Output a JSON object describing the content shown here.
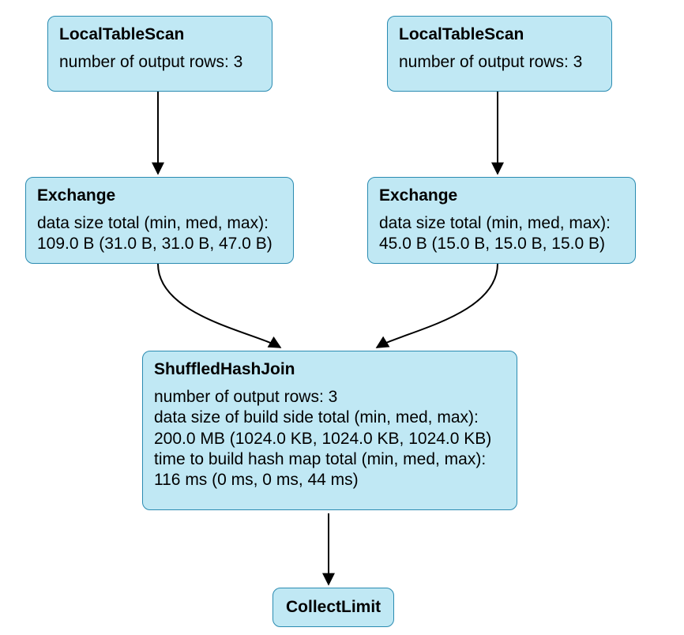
{
  "nodes": {
    "lts_left": {
      "title": "LocalTableScan",
      "body": "number of output rows: 3"
    },
    "lts_right": {
      "title": "LocalTableScan",
      "body": "number of output rows: 3"
    },
    "exchange_left": {
      "title": "Exchange",
      "body": "data size total (min, med, max):\n109.0 B (31.0 B, 31.0 B, 47.0 B)"
    },
    "exchange_right": {
      "title": "Exchange",
      "body": "data size total (min, med, max):\n45.0 B (15.0 B, 15.0 B, 15.0 B)"
    },
    "shj": {
      "title": "ShuffledHashJoin",
      "body": "number of output rows: 3\ndata size of build side total (min, med, max):\n200.0 MB (1024.0 KB, 1024.0 KB, 1024.0 KB)\ntime to build hash map total (min, med, max):\n116 ms (0 ms, 0 ms, 44 ms)"
    },
    "collect": {
      "title": "CollectLimit"
    }
  }
}
